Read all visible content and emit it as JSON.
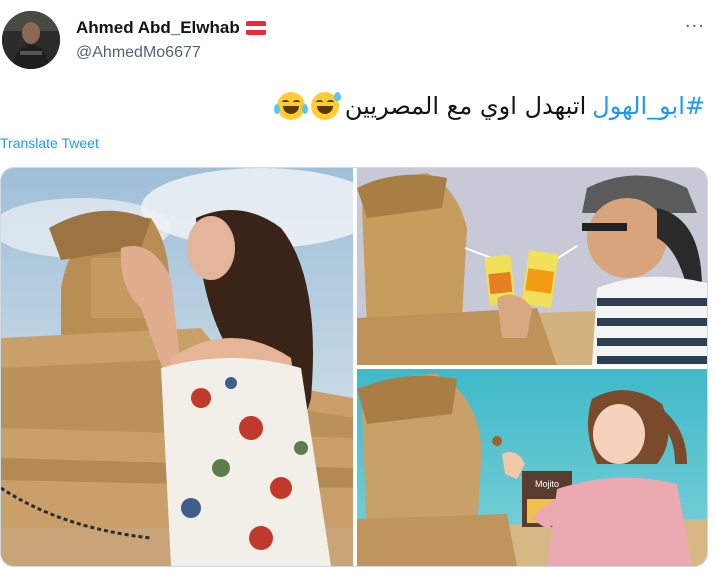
{
  "author": {
    "display_name": "Ahmed Abd_Elwhab",
    "handle": "@AhmedMo6677",
    "avatar_icon": "profile-photo",
    "flag_icon": "austria-flag-icon"
  },
  "menu": {
    "more_icon": "more-options-icon",
    "more_glyph": "···"
  },
  "tweet": {
    "hashtag": "#ابو_الهول",
    "text": "اتبهدل اوي مع المصريين",
    "emojis": [
      "sweat-smile-emoji",
      "joy-emoji"
    ]
  },
  "translate_label": "Translate Tweet",
  "media": {
    "photos": [
      {
        "name": "photo-woman-kissing-sphinx"
      },
      {
        "name": "photo-man-sharing-juice-with-sphinx"
      },
      {
        "name": "photo-girl-offering-mojito-to-sphinx"
      }
    ],
    "mojito_label": "Mojito"
  },
  "colors": {
    "link": "#1d9bf0",
    "secondary_text": "#536471",
    "border": "#cfd9de"
  }
}
